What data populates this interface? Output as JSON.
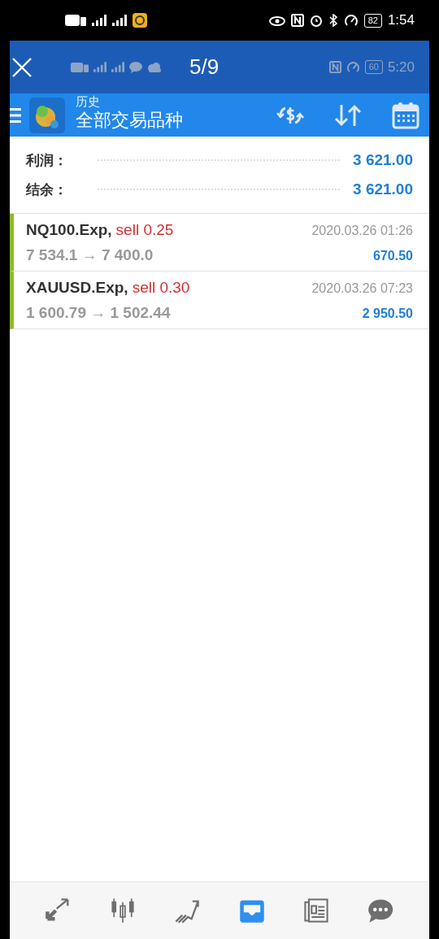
{
  "status_bar": {
    "battery": "82",
    "time": "1:54"
  },
  "viewer": {
    "counter": "5/9",
    "inner_status": {
      "battery": "60",
      "time": "5:20"
    }
  },
  "toolbar": {
    "subtitle": "历史",
    "title": "全部交易品种"
  },
  "summary": [
    {
      "label": "利润：",
      "value": "3 621.00"
    },
    {
      "label": "结余：",
      "value": "3 621.00"
    }
  ],
  "trades": [
    {
      "symbol": "NQ100.Exp,",
      "action": "sell 0.25",
      "prices": "7 534.1 → 7 400.0",
      "time": "2020.03.26 01:26",
      "profit": "670.50"
    },
    {
      "symbol": "XAUUSD.Exp,",
      "action": "sell 0.30",
      "prices": "1 600.79 → 1 502.44",
      "time": "2020.03.26 07:23",
      "profit": "2 950.50"
    }
  ],
  "nav": [
    {
      "kind": "trade",
      "selected": false
    },
    {
      "kind": "chart",
      "selected": false
    },
    {
      "kind": "trend",
      "selected": false
    },
    {
      "kind": "history",
      "selected": true
    },
    {
      "kind": "news",
      "selected": false
    },
    {
      "kind": "chat",
      "selected": false
    }
  ]
}
